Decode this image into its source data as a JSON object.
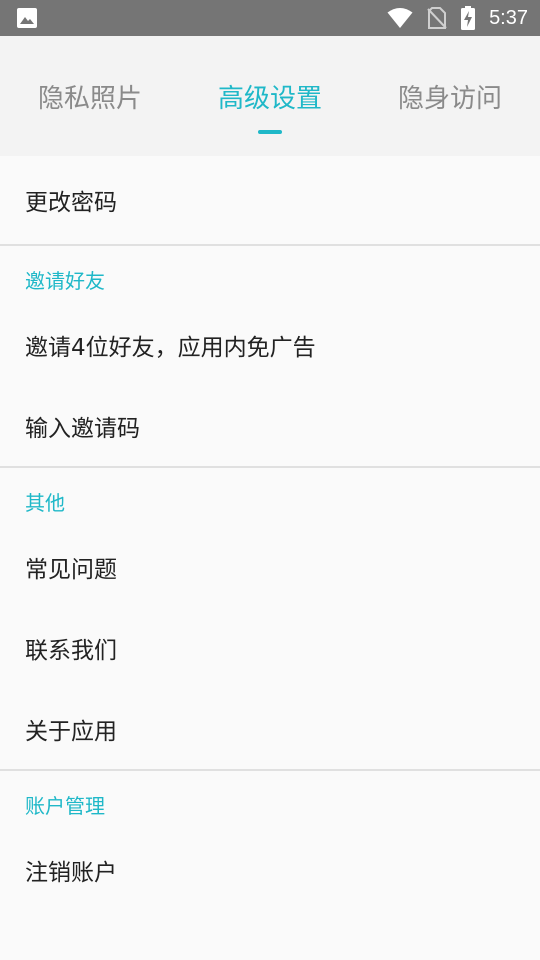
{
  "status_bar": {
    "time": "5:37",
    "icons": [
      "image-icon",
      "wifi-icon",
      "no-sim-icon",
      "battery-charging-icon"
    ]
  },
  "tabs": [
    {
      "label": "隐私照片",
      "active": false
    },
    {
      "label": "高级设置",
      "active": true
    },
    {
      "label": "隐身访问",
      "active": false
    }
  ],
  "items": {
    "change_password": "更改密码"
  },
  "sections": {
    "invite": {
      "header": "邀请好友",
      "items": [
        "邀请4位好友，应用内免广告",
        "输入邀请码"
      ]
    },
    "other": {
      "header": "其他",
      "items": [
        "常见问题",
        "联系我们",
        "关于应用"
      ]
    },
    "account": {
      "header": "账户管理",
      "items": [
        "注销账户"
      ]
    }
  },
  "colors": {
    "accent": "#1fb8c8",
    "status_bar": "#757575",
    "tab_bg": "#f3f3f3",
    "bg": "#fafafa"
  }
}
